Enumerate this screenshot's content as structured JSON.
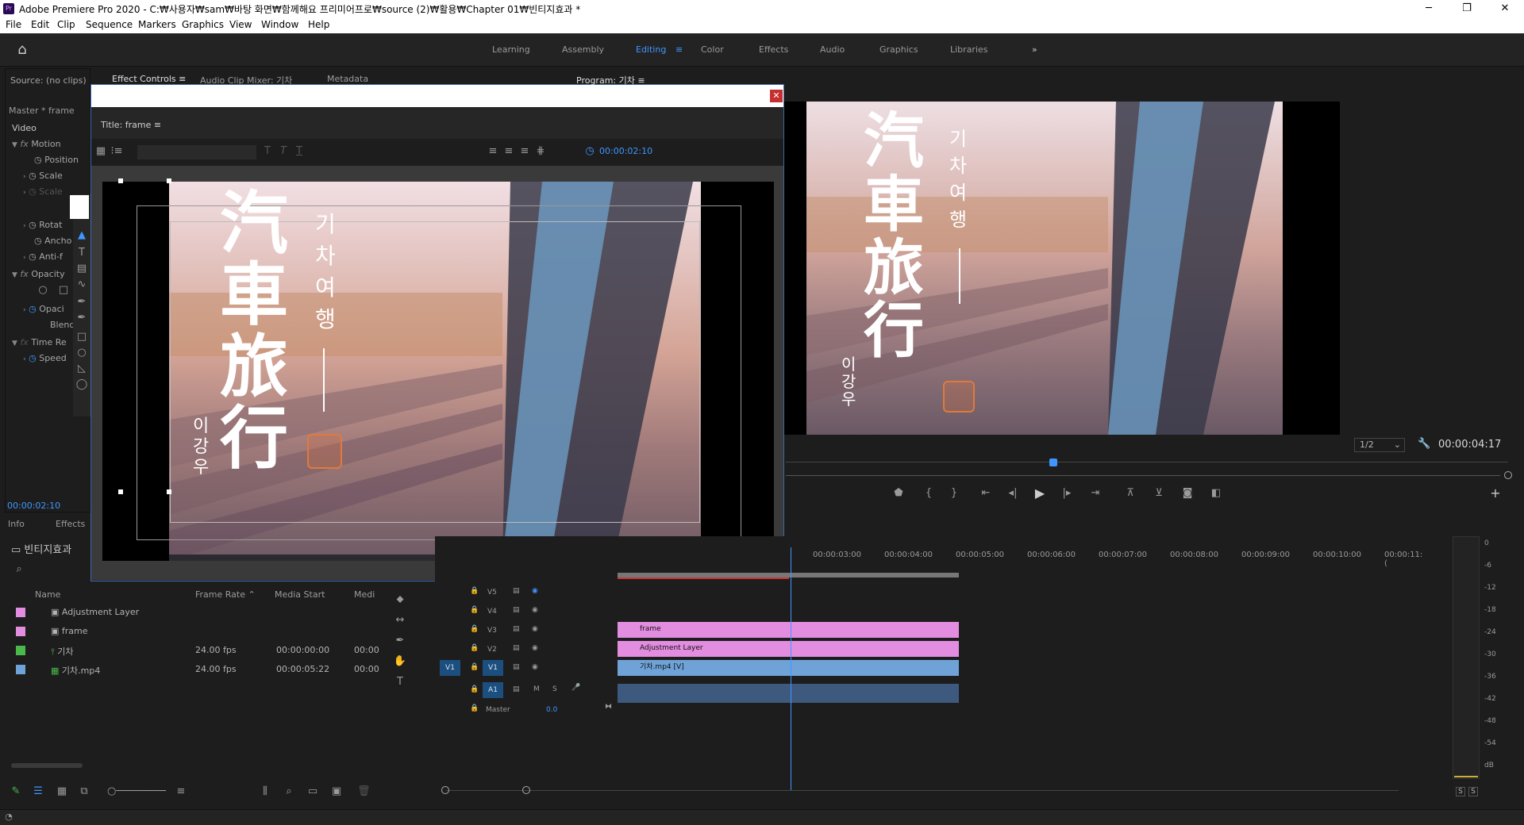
{
  "app": {
    "title": "Adobe Premiere Pro 2020 - C:₩사용자₩sam₩바탕 화면₩함께해요 프리미어프로₩source (2)₩활용₩Chapter 01₩빈티지효과 *",
    "logo": "Pr"
  },
  "menu": [
    "File",
    "Edit",
    "Clip",
    "Sequence",
    "Markers",
    "Graphics",
    "View",
    "Window",
    "Help"
  ],
  "workspaces": [
    "Learning",
    "Assembly",
    "Editing",
    "Color",
    "Effects",
    "Audio",
    "Graphics",
    "Libraries"
  ],
  "workspace_active": "Editing",
  "source_panel": {
    "tabs": [
      "Source: (no clips)",
      "Effect Controls",
      "Audio Clip Mixer: 기차",
      "Metadata"
    ],
    "master_label": "Master * frame",
    "video_label": "Video",
    "rows": [
      "Motion",
      "Position",
      "Scale",
      "Scale",
      "Rotat",
      "Ancho",
      "Anti-f",
      "Opacity",
      "Opaci",
      "Blend",
      "Time Re",
      "Speed"
    ],
    "timecode": "00:00:02:10"
  },
  "title_dialog": {
    "panel_title": "Title: frame",
    "timecode": "00:00:02:10"
  },
  "overlay_text": {
    "hanja_1": "汽",
    "hanja_2": "車",
    "hanja_3": "旅",
    "hanja_4": "行",
    "korean_title": [
      "기",
      "차",
      "여",
      "행"
    ],
    "author": [
      "이",
      "강",
      "우"
    ]
  },
  "program": {
    "tab": "Program: 기차",
    "zoom": "1/2",
    "timecode": "00:00:04:17"
  },
  "project_panel": {
    "tabs": [
      "Info",
      "Effects"
    ],
    "bin_name": "빈티지효과",
    "columns": [
      "Name",
      "Frame Rate",
      "Media Start",
      "Medi"
    ],
    "items": [
      {
        "name": "Adjustment Layer",
        "fps": "",
        "start": "",
        "color": "#e38de0"
      },
      {
        "name": "frame",
        "fps": "",
        "start": "",
        "color": "#e38de0"
      },
      {
        "name": "기차",
        "fps": "24.00 fps",
        "start": "00:00:00:00",
        "end": "00:00",
        "color": "#4ab84a"
      },
      {
        "name": "기차.mp4",
        "fps": "24.00 fps",
        "start": "00:00:05:22",
        "end": "00:00",
        "color": "#6fa3d8"
      }
    ]
  },
  "timeline": {
    "ruler": [
      "00:00:03:00",
      "00:00:04:00",
      "00:00:05:00",
      "00:00:06:00",
      "00:00:07:00",
      "00:00:08:00",
      "00:00:09:00",
      "00:00:10:00",
      "00:00:11:("
    ],
    "tracks": [
      "V5",
      "V4",
      "V3",
      "V2",
      "V1",
      "A1"
    ],
    "master_label": "Master",
    "master_value": "0.0",
    "source_patch_v": "V1",
    "mute_label": "M",
    "solo_label": "S",
    "clips": [
      {
        "track": "V3",
        "label": "frame",
        "color": "#e38de0"
      },
      {
        "track": "V2",
        "label": "Adjustment Layer",
        "color": "#e38de0"
      },
      {
        "track": "V1",
        "label": "기차.mp4 [V]",
        "color": "#6fa3d8"
      }
    ]
  },
  "meters": {
    "labels": [
      "0",
      "-6",
      "-12",
      "-18",
      "-24",
      "-30",
      "-36",
      "-42",
      "-48",
      "-54",
      "dB"
    ],
    "solo_buttons": [
      "S",
      "S"
    ]
  }
}
